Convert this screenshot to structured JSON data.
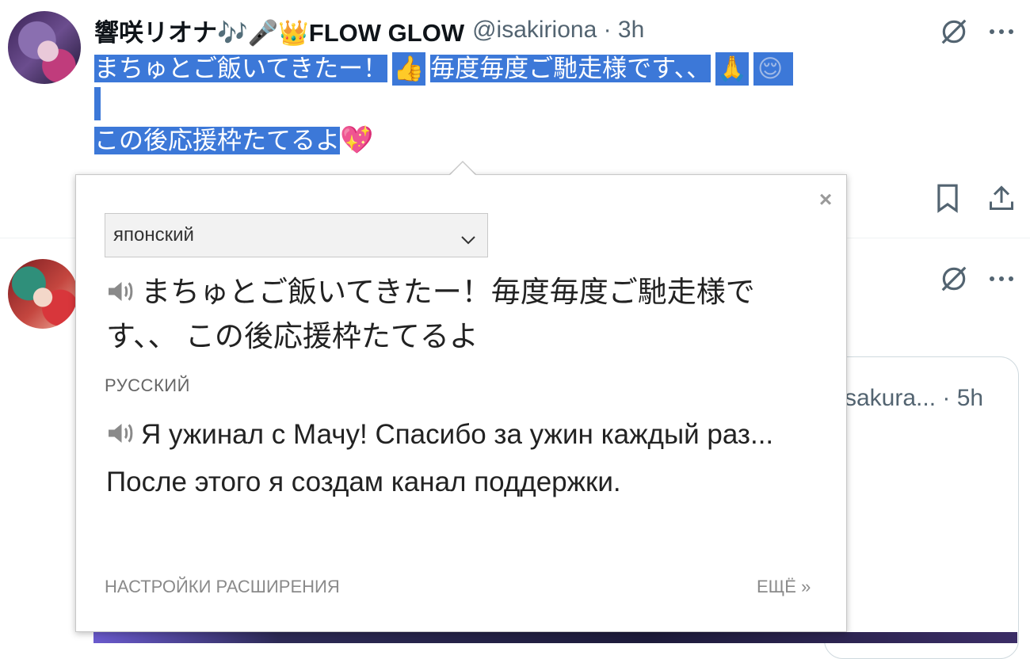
{
  "tweet1": {
    "name": "響咲リオナ🎶🎤👑FLOW GLOW",
    "handle_time": "@isakiriona · 3h",
    "text_line1a": "まちゅとご飯いてきたー！",
    "text_line1b": "毎度毎度ご馳走様です、、",
    "text_line3": "この後応援枠たてるよ",
    "heart_emoji": "💖"
  },
  "tweet2": {
    "time_fragment": "h",
    "quote_meta": "sakura... · 5h"
  },
  "popup": {
    "source_language": "японский",
    "source_text": "まちゅとご飯いてきたー！毎度毎度ご馳走様です、、 この後応援枠たてるよ",
    "target_language": "РУССКИЙ",
    "translation": "Я ужинал с Мачу! Спасибо за ужин каждый раз... После этого я создам канал поддержки.",
    "settings_link": "НАСТРОЙКИ РАСШИРЕНИЯ",
    "more_link": "ЕЩЁ »",
    "close_symbol": "×"
  },
  "icons": {
    "tweet_actions": [
      "grok-icon",
      "more-icon",
      "bookmark-icon",
      "share-icon"
    ],
    "popup": [
      "speaker-icon",
      "chevron-down-icon",
      "close-icon"
    ]
  },
  "colors": {
    "selection": "#3c78d8",
    "muted_text": "#536471",
    "popup_border": "#c8c8c8"
  }
}
